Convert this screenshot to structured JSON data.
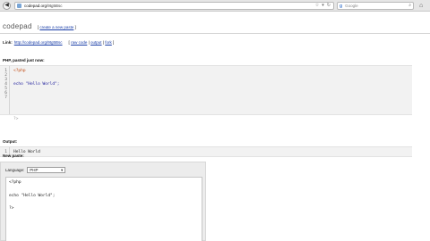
{
  "browser": {
    "url_host": "codepad.org",
    "url_path": "/9tg5Bsc",
    "search_placeholder": "Google",
    "search_engine_glyph": "g",
    "back_glyph": "◀",
    "home_glyph": "⌂",
    "url_icons": [
      "☆",
      "▾",
      "↻"
    ]
  },
  "header": {
    "logo": "codepad",
    "create_link_open": "[",
    "create_link": "create a new paste",
    "create_link_close": "]"
  },
  "link_row": {
    "label": "Link:",
    "url": "http://codepad.org/9tg5Bsc",
    "actions_open": "[",
    "raw_code": "raw code",
    "sep1": "|",
    "output": "output",
    "sep2": "|",
    "fork": "fork",
    "actions_close": "]"
  },
  "source": {
    "title": "PHP, pasted just now:",
    "line_numbers": [
      "1",
      "2",
      "3",
      "4",
      "5",
      "6",
      "7"
    ],
    "lines": [
      "<?php",
      "",
      "",
      "echo \"Hello World\";",
      "",
      "",
      "?>"
    ]
  },
  "output": {
    "title": "Output:",
    "line_numbers": [
      "1"
    ],
    "lines": [
      "Hello World"
    ]
  },
  "new_paste": {
    "title": "New paste:",
    "language_label": "Language:",
    "language_value": "PHP",
    "editor_lines": [
      "<?php",
      "",
      "echo \"Hello World\";",
      "",
      "?>"
    ]
  },
  "colors": {
    "link": "#1a3ea8",
    "code_bg": "#f2f2f2",
    "php_tag": "#c34c12"
  }
}
